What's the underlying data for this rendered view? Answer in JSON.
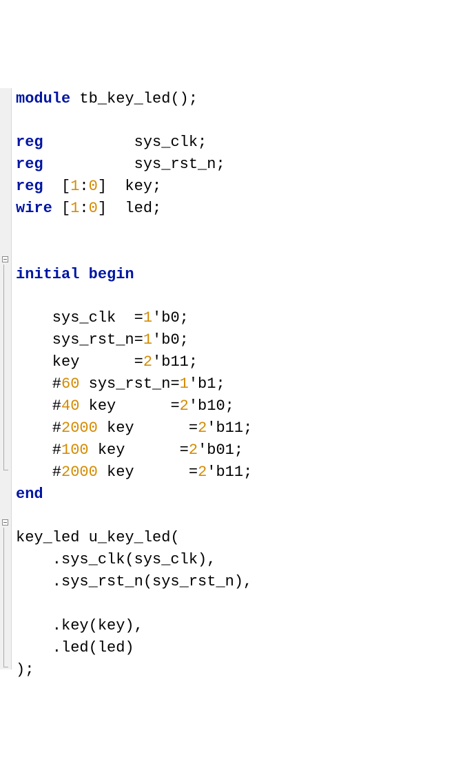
{
  "kw": {
    "module": "module",
    "reg": "reg",
    "wire": "wire",
    "initial": "initial",
    "begin": "begin",
    "end": "end"
  },
  "decl": {
    "module_name": " tb_key_led();",
    "range": "[",
    "range_hi": "1",
    "range_sep": ":",
    "range_lo": "0",
    "range_close": "]",
    "sys_clk": "          sys_clk;",
    "sys_rst_n": "          sys_rst_n;",
    "key_pad": "  ",
    "key_rest": "  key;",
    "wire_pad": " ",
    "led_rest": "  led;"
  },
  "init": {
    "l1a": "    sys_clk  =",
    "l1b": "1",
    "l1c": "'b0;",
    "l2a": "    sys_rst_n=",
    "l2b": "1",
    "l2c": "'b0;",
    "l3a": "    key      =",
    "l3b": "2",
    "l3c": "'b11;",
    "l4a": "    #",
    "l4b": "60",
    "l4c": " sys_rst_n=",
    "l4d": "1",
    "l4e": "'b1;",
    "l5a": "    #",
    "l5b": "40",
    "l5c": " key      =",
    "l5d": "2",
    "l5e": "'b10;",
    "l6a": "    #",
    "l6b": "2000",
    "l6c": " key      =",
    "l6d": "2",
    "l6e": "'b11;",
    "l7a": "    #",
    "l7b": "100",
    "l7c": " key      =",
    "l7d": "2",
    "l7e": "'b01;",
    "l8a": "    #",
    "l8b": "2000",
    "l8c": " key      =",
    "l8d": "2",
    "l8e": "'b11;"
  },
  "inst": {
    "head": "key_led u_key_led(",
    "p1": "    .sys_clk(sys_clk),",
    "p2": "    .sys_rst_n(sys_rst_n),",
    "blank": "    ",
    "p3": "    .key(key),",
    "p4": "    .led(led)",
    "close": ");"
  }
}
